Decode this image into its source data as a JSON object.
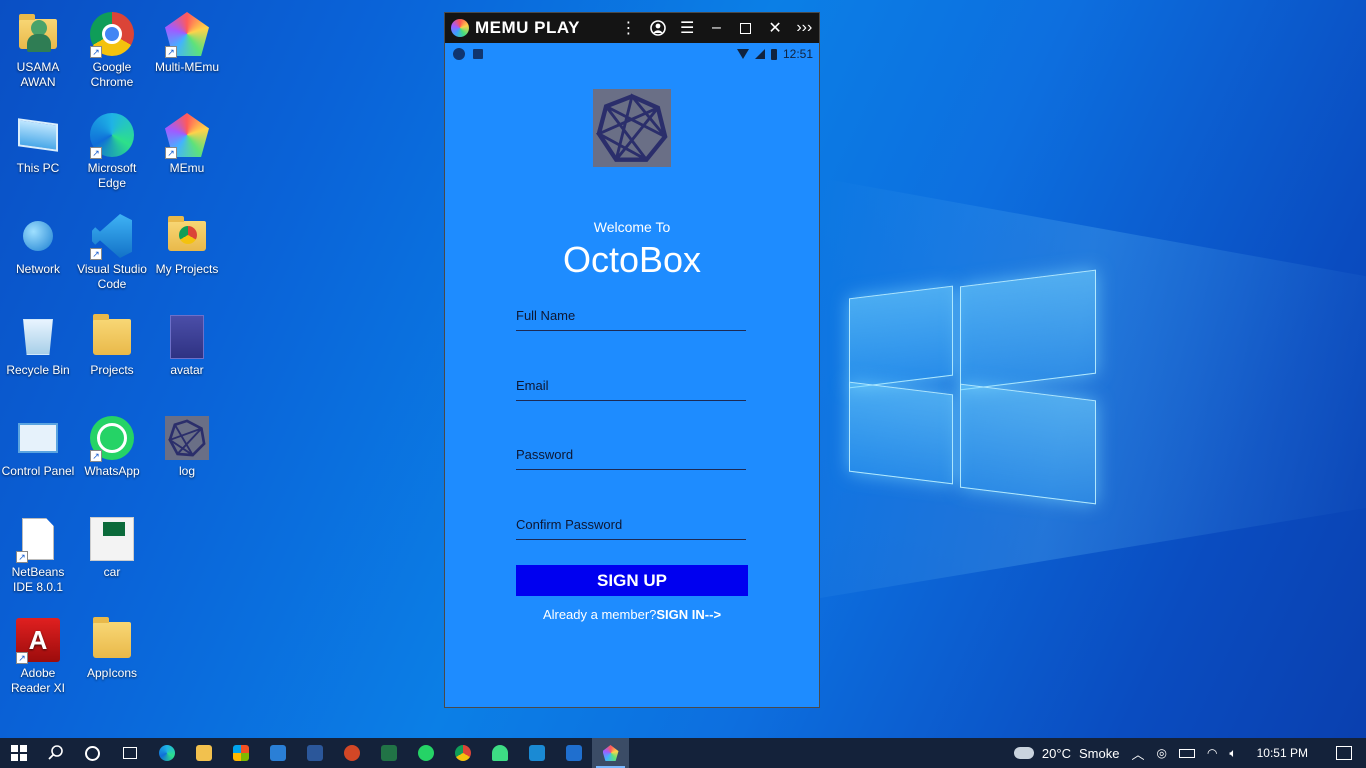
{
  "desktop": {
    "icons": [
      {
        "label": "USAMA AWAN",
        "icon": "user-folder-icon"
      },
      {
        "label": "Google Chrome",
        "icon": "chrome-icon"
      },
      {
        "label": "Multi-MEmu",
        "icon": "multi-memu-icon"
      },
      {
        "label": "This PC",
        "icon": "this-pc-icon"
      },
      {
        "label": "Microsoft Edge",
        "icon": "edge-icon"
      },
      {
        "label": "MEmu",
        "icon": "memu-icon"
      },
      {
        "label": "Network",
        "icon": "network-icon"
      },
      {
        "label": "Visual Studio Code",
        "icon": "vscode-icon"
      },
      {
        "label": "My Projects",
        "icon": "chrome-folder-icon"
      },
      {
        "label": "Recycle Bin",
        "icon": "recycle-bin-icon"
      },
      {
        "label": "Projects",
        "icon": "folder-icon"
      },
      {
        "label": "avatar",
        "icon": "image-thumbnail-icon"
      },
      {
        "label": "Control Panel",
        "icon": "control-panel-icon"
      },
      {
        "label": "WhatsApp",
        "icon": "whatsapp-icon"
      },
      {
        "label": "log",
        "icon": "octobox-logo-icon"
      },
      {
        "label": "NetBeans IDE 8.0.1",
        "icon": "file-icon"
      },
      {
        "label": "car",
        "icon": "flag-image-icon"
      },
      {
        "label": "Adobe Reader XI",
        "icon": "acrobat-icon"
      },
      {
        "label": "AppIcons",
        "icon": "folder-icon"
      }
    ]
  },
  "emulator": {
    "brand": "MEMU PLAY",
    "status": {
      "time": "12:51"
    },
    "app": {
      "welcome": "Welcome To",
      "name": "OctoBox",
      "fields": {
        "full_name": "Full Name",
        "email": "Email",
        "password": "Password",
        "confirm_password": "Confirm Password"
      },
      "signup_label": "SIGN UP",
      "member_text": "Already a member?",
      "signin_link": "SIGN IN-->"
    }
  },
  "taskbar": {
    "weather": {
      "temp": "20°C",
      "condition": "Smoke"
    },
    "clock": "10:51 PM"
  },
  "colors": {
    "app_bg": "#1e8cff",
    "signup_button": "#0000f0",
    "taskbar": "#14223a"
  }
}
